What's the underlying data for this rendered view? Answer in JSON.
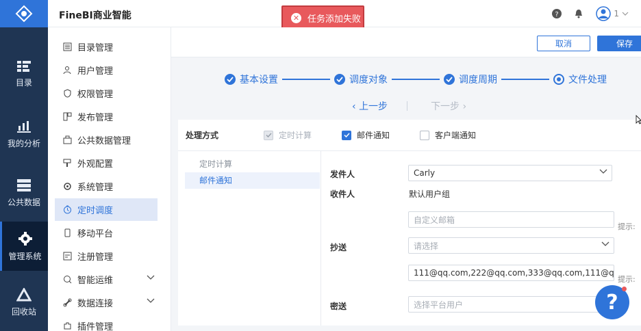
{
  "app": {
    "brand": "FineBI商业智能",
    "user_count": "1"
  },
  "toast": {
    "text": "任务添加失败",
    "color": "#e8595c"
  },
  "rail": [
    {
      "label": "目录",
      "icon": "catalog-icon"
    },
    {
      "label": "我的分析",
      "icon": "analysis-icon"
    },
    {
      "label": "公共数据",
      "icon": "public-data-icon"
    },
    {
      "label": "管理系统",
      "icon": "gear-icon",
      "active": true
    },
    {
      "label": "回收站",
      "icon": "recycle-icon"
    }
  ],
  "menu": [
    {
      "label": "目录管理",
      "icon": "catalog-manage-icon"
    },
    {
      "label": "用户管理",
      "icon": "user-manage-icon"
    },
    {
      "label": "权限管理",
      "icon": "permission-icon"
    },
    {
      "label": "发布管理",
      "icon": "publish-icon"
    },
    {
      "label": "公共数据管理",
      "icon": "public-data-manage-icon"
    },
    {
      "label": "外观配置",
      "icon": "appearance-icon"
    },
    {
      "label": "系统管理",
      "icon": "system-gear-icon"
    },
    {
      "label": "定时调度",
      "icon": "timer-icon",
      "active": true
    },
    {
      "label": "移动平台",
      "icon": "mobile-icon"
    },
    {
      "label": "注册管理",
      "icon": "register-icon"
    },
    {
      "label": "智能运维",
      "icon": "ops-icon",
      "expandable": true
    },
    {
      "label": "数据连接",
      "icon": "link-icon",
      "expandable": true
    },
    {
      "label": "插件管理",
      "icon": "plugin-icon"
    }
  ],
  "actions": {
    "cancel": "取消",
    "save": "保存"
  },
  "steps": [
    {
      "label": "基本设置",
      "state": "done"
    },
    {
      "label": "调度对象",
      "state": "done"
    },
    {
      "label": "调度周期",
      "state": "done"
    },
    {
      "label": "文件处理",
      "state": "current"
    }
  ],
  "stepnav": {
    "prev": "上一步",
    "next": "下一步"
  },
  "mode": {
    "label": "处理方式",
    "options": [
      {
        "label": "定时计算",
        "checked": true,
        "disabled": true
      },
      {
        "label": "邮件通知",
        "checked": true,
        "disabled": false
      },
      {
        "label": "客户端通知",
        "checked": false,
        "disabled": false
      }
    ]
  },
  "left_list": [
    {
      "label": "定时计算",
      "selected": false
    },
    {
      "label": "邮件通知",
      "selected": true
    }
  ],
  "form": {
    "sender_label": "发件人",
    "sender_value": "Carly",
    "recipient_label": "收件人",
    "recipient_value": "默认用户组",
    "custom_mail_placeholder": "自定义邮箱",
    "hint_1": "提示:",
    "cc_label": "抄送",
    "cc_placeholder": "请选择",
    "cc_emails": "111@qq.com,222@qq.com,333@qq.com,111@q...",
    "hint_2": "提示:",
    "bcc_label": "密送",
    "bcc_placeholder": "选择平台用户"
  },
  "help": {
    "label": "?"
  },
  "colors": {
    "accent": "#2f74d9",
    "rail_bg": "#1f3553",
    "error": "#e8595c"
  }
}
